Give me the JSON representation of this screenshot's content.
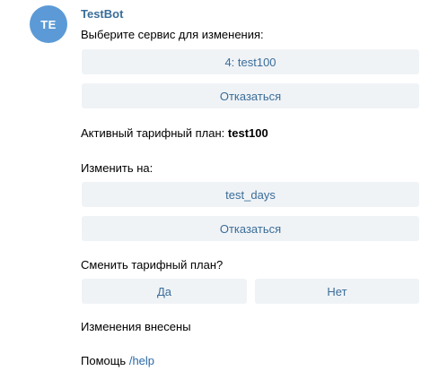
{
  "sender": {
    "avatar_initials": "TE",
    "name": "TestBot",
    "avatar_color": "#5b9ad6"
  },
  "messages": {
    "select_service": "Выберите сервис для изменения:",
    "service_button": "4: test100",
    "cancel_button_1": "Отказаться",
    "active_plan_prefix": "Активный тарифный план:",
    "active_plan_value": "test100",
    "change_to": "Изменить на:",
    "plan_option_button": "test_days",
    "cancel_button_2": "Отказаться",
    "confirm_question": "Сменить тарифный план?",
    "yes_button": "Да",
    "no_button": "Нет",
    "changes_applied": "Изменения внесены",
    "help_prefix": "Помощь",
    "help_command": "/help"
  },
  "colors": {
    "accent": "#3a6d99",
    "button_bg": "#f0f3f6",
    "link": "#2b6aa6"
  }
}
